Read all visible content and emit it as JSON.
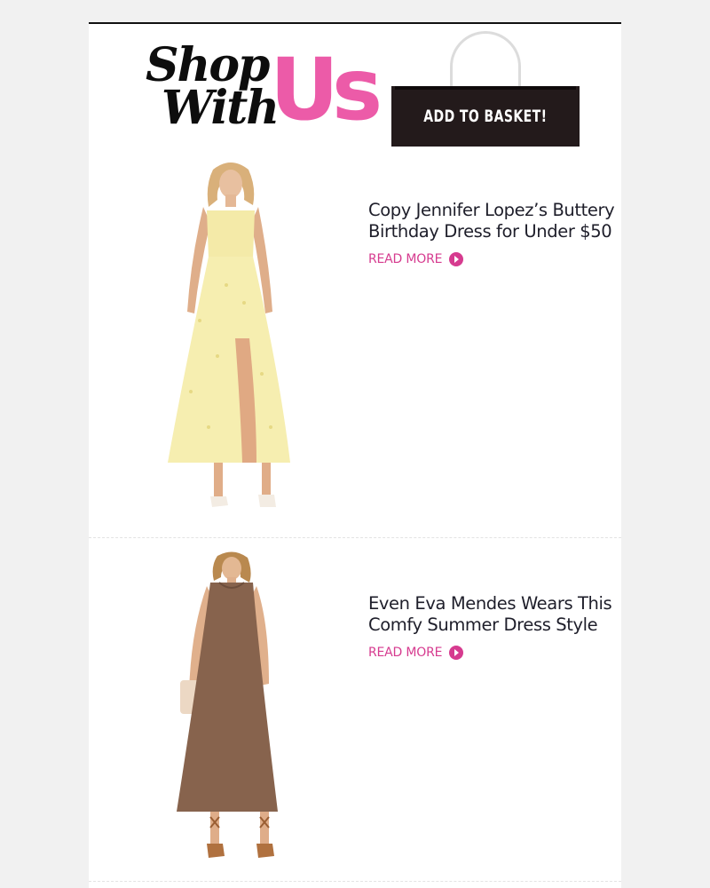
{
  "header": {
    "logo": {
      "line1": "Shop",
      "line2": "With",
      "brand": "Us",
      "brand_color": "#ec5ba8"
    },
    "cta_label": "ADD TO BASKET!"
  },
  "products": [
    {
      "title_line1": "Copy Jennifer Lopez’s Buttery",
      "title_line2": "Birthday Dress for Under $50",
      "read_more": "READ MORE",
      "image": "yellow-floral-maxi-dress"
    },
    {
      "title_line1": "Even Eva Mendes Wears This",
      "title_line2": "Comfy Summer Dress Style",
      "read_more": "READ MORE",
      "image": "brown-sleeveless-maxi-dress"
    }
  ],
  "colors": {
    "accent": "#d63b8f",
    "title": "#1e1e2a",
    "bag": "#231a1b"
  }
}
